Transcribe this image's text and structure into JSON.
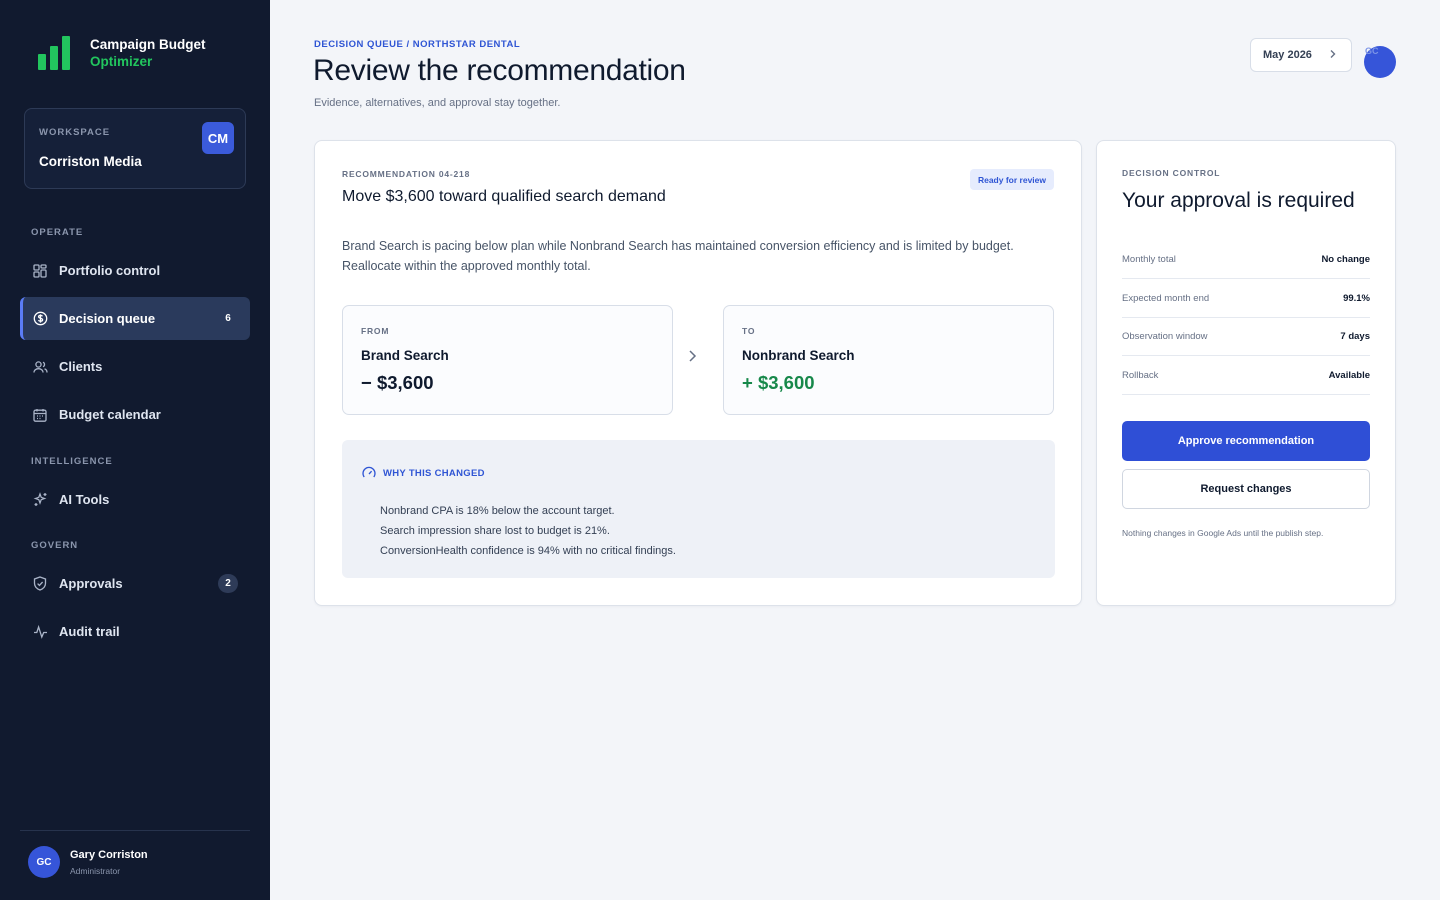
{
  "brand": {
    "line1": "Campaign Budget",
    "line2": "Optimizer",
    "accent": "#22c55e"
  },
  "workspace": {
    "label": "WORKSPACE",
    "name": "Corriston Media",
    "badge": "CM"
  },
  "sidebar": {
    "sections": [
      "OPERATE",
      "INTELLIGENCE",
      "GOVERN"
    ],
    "items": [
      {
        "label": "Portfolio control",
        "icon": "grid-icon"
      },
      {
        "label": "Decision queue",
        "icon": "dollar-circle-icon",
        "count": "6",
        "active": true
      },
      {
        "label": "Clients",
        "icon": "users-icon"
      },
      {
        "label": "Budget calendar",
        "icon": "calendar-icon"
      },
      {
        "label": "AI Tools",
        "icon": "sparkles-icon"
      },
      {
        "label": "Approvals",
        "icon": "shield-check-icon",
        "count": "2"
      },
      {
        "label": "Audit trail",
        "icon": "activity-icon"
      }
    ]
  },
  "user": {
    "initials": "GC",
    "name": "Gary Corriston",
    "role": "Administrator"
  },
  "header": {
    "breadcrumb": "DECISION QUEUE / NORTHSTAR DENTAL",
    "title": "Review the recommendation",
    "subtitle": "Evidence, alternatives, and approval stay together.",
    "month": "May 2026",
    "avatar_initials": "GC"
  },
  "recommendation": {
    "id": "RECOMMENDATION 04-218",
    "title": "Move $3,600 toward qualified search demand",
    "status": "Ready for review",
    "description": "Brand Search is pacing below plan while Nonbrand Search has maintained conversion efficiency and is limited by budget. Reallocate within the approved monthly total.",
    "from": {
      "label": "FROM",
      "name": "Brand Search",
      "amount": "− $3,600"
    },
    "to": {
      "label": "TO",
      "name": "Nonbrand Search",
      "amount": "+ $3,600"
    },
    "why": {
      "title": "WHY THIS CHANGED",
      "points": [
        "Nonbrand CPA is 18% below the account target.",
        "Search impression share lost to budget is 21%.",
        "ConversionHealth confidence is 94% with no critical findings."
      ]
    }
  },
  "decision": {
    "label": "DECISION CONTROL",
    "title": "Your approval is required",
    "rows": [
      {
        "key": "Monthly total",
        "value": "No change"
      },
      {
        "key": "Expected month end",
        "value": "99.1%"
      },
      {
        "key": "Observation window",
        "value": "7 days"
      },
      {
        "key": "Rollback",
        "value": "Available"
      }
    ],
    "approve_label": "Approve recommendation",
    "request_label": "Request changes",
    "note": "Nothing changes in Google Ads until the publish step."
  },
  "colors": {
    "sidebar_bg": "#111a2f",
    "primary": "#2f4fd6",
    "positive": "#17884a"
  }
}
